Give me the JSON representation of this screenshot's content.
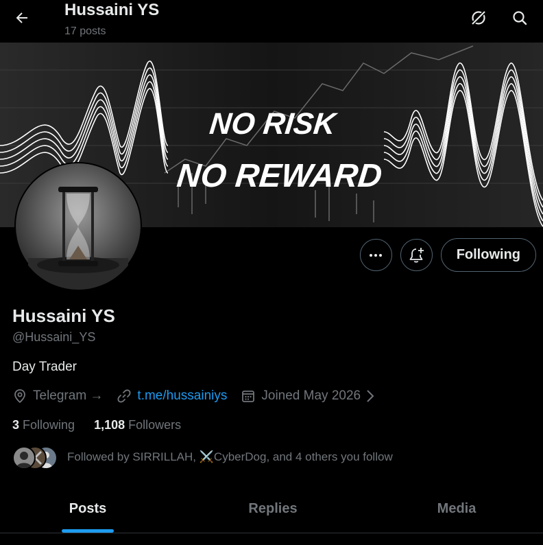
{
  "header": {
    "title": "Hussaini YS",
    "post_count": "17 posts"
  },
  "banner": {
    "line1": "NO RISK",
    "line2": "NO REWARD"
  },
  "actions": {
    "following_label": "Following"
  },
  "profile": {
    "name": "Hussaini YS",
    "handle": "@Hussaini_YS",
    "bio": "Day Trader",
    "location": "Telegram →",
    "website": "t.me/hussainiys",
    "joined": "Joined May 2026"
  },
  "stats": {
    "following_count": "3",
    "following_label": "Following",
    "followers_count": "1,108",
    "followers_label": "Followers"
  },
  "followed_by": {
    "text": "Followed by SIRRILLAH, ⚔️CyberDog, and 4 others you follow"
  },
  "tabs": [
    {
      "label": "Posts"
    },
    {
      "label": "Replies"
    },
    {
      "label": "Media"
    }
  ],
  "colors": {
    "accent": "#1d9bf0",
    "muted": "#71767b",
    "text": "#e7e9ea"
  }
}
